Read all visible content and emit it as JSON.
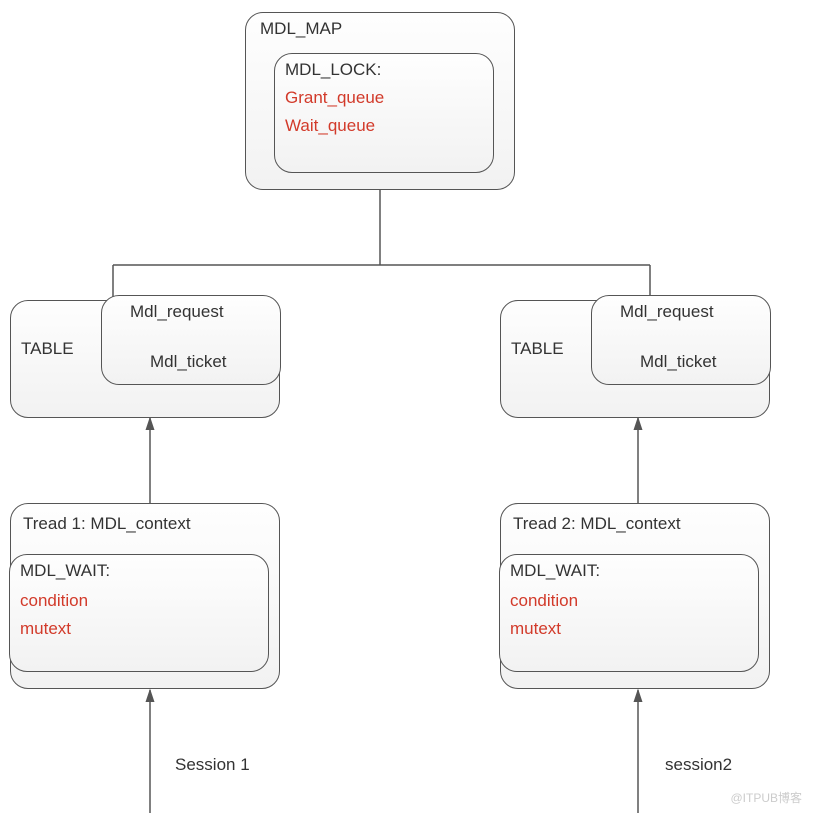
{
  "mdl_map": {
    "title": "MDL_MAP",
    "lock": {
      "title": "MDL_LOCK:",
      "field1": "Grant_queue",
      "field2": "Wait_queue"
    }
  },
  "tables": {
    "left": {
      "title": "TABLE",
      "request": "Mdl_request",
      "ticket": "Mdl_ticket"
    },
    "right": {
      "title": "TABLE",
      "request": "Mdl_request",
      "ticket": "Mdl_ticket"
    }
  },
  "threads": {
    "left": {
      "title": "Tread 1: MDL_context",
      "wait_title": "MDL_WAIT:",
      "field1": "condition",
      "field2": "mutext"
    },
    "right": {
      "title": "Tread 2: MDL_context",
      "wait_title": "MDL_WAIT:",
      "field1": "condition",
      "field2": "mutext"
    }
  },
  "sessions": {
    "left": "Session 1",
    "right": "session2"
  },
  "watermark": "@ITPUB博客"
}
